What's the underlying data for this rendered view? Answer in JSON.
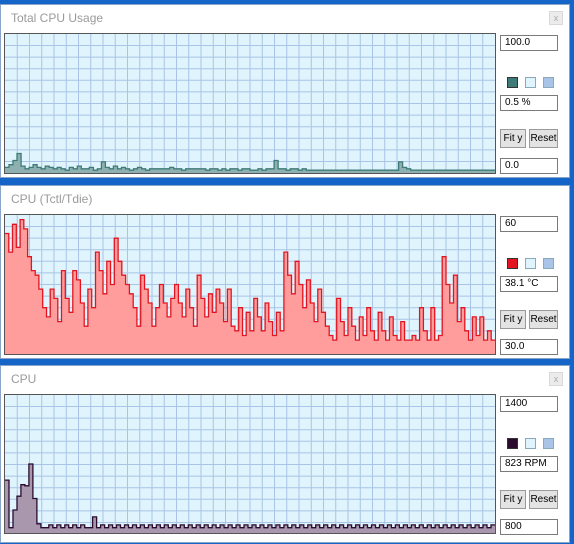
{
  "panels": [
    {
      "title": "Total CPU Usage",
      "max_value": "100.0",
      "current_value": "0.5 %",
      "min_value": "0.0",
      "fit_label": "Fit y",
      "reset_label": "Reset",
      "close_label": "x",
      "series_color": "#3e7b78",
      "fill_color": "#8fb0b0"
    },
    {
      "title": "CPU (Tctl/Tdie)",
      "max_value": "60",
      "current_value": "38.1 °C",
      "min_value": "30.0",
      "fit_label": "Fit y",
      "reset_label": "Reset",
      "close_label": "x",
      "series_color": "#e3141f",
      "fill_color": "#ff9d9d"
    },
    {
      "title": "CPU",
      "max_value": "1400",
      "current_value": "823 RPM",
      "min_value": "800",
      "fit_label": "Fit y",
      "reset_label": "Reset",
      "close_label": "x",
      "series_color": "#2a0b2e",
      "fill_color": "#a897ad"
    }
  ],
  "chart_data": [
    {
      "type": "area",
      "title": "Total CPU Usage",
      "ylim": [
        0,
        100
      ],
      "unit": "%",
      "grid": true,
      "values": [
        4,
        6,
        9,
        14,
        5,
        3,
        4,
        6,
        4,
        3,
        5,
        4,
        3,
        4,
        3,
        2,
        4,
        3,
        5,
        3,
        3,
        4,
        2,
        3,
        8,
        4,
        3,
        5,
        3,
        4,
        3,
        2,
        3,
        4,
        3,
        2,
        3,
        3,
        3,
        3,
        3,
        4,
        3,
        3,
        2,
        3,
        3,
        3,
        3,
        3,
        2,
        3,
        3,
        2,
        3,
        2,
        3,
        3,
        2,
        3,
        3,
        2,
        2,
        3,
        2,
        3,
        3,
        9,
        3,
        3,
        2,
        3,
        3,
        2,
        3,
        2,
        2,
        2,
        2,
        2,
        2,
        2,
        2,
        2,
        2,
        2,
        2,
        2,
        2,
        2,
        2,
        2,
        2,
        2,
        2,
        2,
        2,
        2,
        8,
        4,
        3,
        2,
        2,
        2,
        2,
        2,
        2,
        2,
        2,
        2,
        2,
        2,
        2,
        2,
        2,
        2,
        2,
        2,
        2,
        2,
        2,
        2
      ]
    },
    {
      "type": "area",
      "title": "CPU (Tctl/Tdie)",
      "ylim": [
        30,
        60
      ],
      "unit": "°C",
      "grid": true,
      "values": [
        56,
        52,
        58,
        53,
        59,
        57,
        51,
        48,
        47,
        44,
        40,
        38,
        44,
        42,
        37,
        48,
        42,
        39,
        48,
        46,
        41,
        36,
        44,
        40,
        52,
        48,
        43,
        50,
        45,
        55,
        50,
        47,
        45,
        43,
        40,
        36,
        47,
        44,
        41,
        36,
        40,
        45,
        41,
        38,
        42,
        45,
        41,
        38,
        44,
        40,
        36,
        47,
        42,
        38,
        43,
        39,
        44,
        41,
        37,
        44,
        36,
        35,
        40,
        34,
        39,
        35,
        42,
        38,
        35,
        41,
        37,
        34,
        39,
        35,
        52,
        47,
        43,
        50,
        45,
        40,
        46,
        41,
        37,
        44,
        39,
        36,
        34,
        33,
        42,
        37,
        34,
        40,
        36,
        33,
        38,
        34,
        40,
        35,
        33,
        39,
        35,
        33,
        38,
        34,
        33,
        37,
        33,
        33,
        34,
        33,
        40,
        35,
        33,
        40,
        33,
        34,
        51,
        45,
        41,
        47,
        37,
        40,
        35,
        33,
        38,
        34,
        38,
        33,
        35,
        33
      ]
    },
    {
      "type": "area",
      "title": "CPU",
      "ylim": [
        800,
        1400
      ],
      "unit": "RPM",
      "grid": true,
      "values": [
        1030,
        823,
        900,
        960,
        1010,
        1005,
        1100,
        950,
        840,
        823,
        823,
        835,
        823,
        835,
        823,
        835,
        823,
        835,
        823,
        835,
        823,
        823,
        870,
        823,
        835,
        823,
        835,
        823,
        835,
        823,
        835,
        823,
        835,
        823,
        835,
        823,
        835,
        823,
        835,
        823,
        835,
        823,
        835,
        823,
        835,
        823,
        835,
        823,
        835,
        823,
        835,
        823,
        835,
        823,
        835,
        823,
        835,
        823,
        835,
        823,
        835,
        823,
        835,
        823,
        835,
        823,
        835,
        823,
        835,
        823,
        835,
        823,
        835,
        823,
        835,
        823,
        835,
        823,
        835,
        823,
        835,
        823,
        835,
        823,
        835,
        823,
        835,
        823,
        835,
        823,
        835,
        823,
        835,
        823,
        835,
        823,
        835,
        823,
        835,
        823,
        835,
        823,
        835,
        823,
        835,
        823,
        835,
        823,
        835,
        823,
        835,
        823,
        835,
        823,
        835,
        823,
        835,
        823,
        835,
        823,
        835,
        823,
        835
      ]
    }
  ]
}
